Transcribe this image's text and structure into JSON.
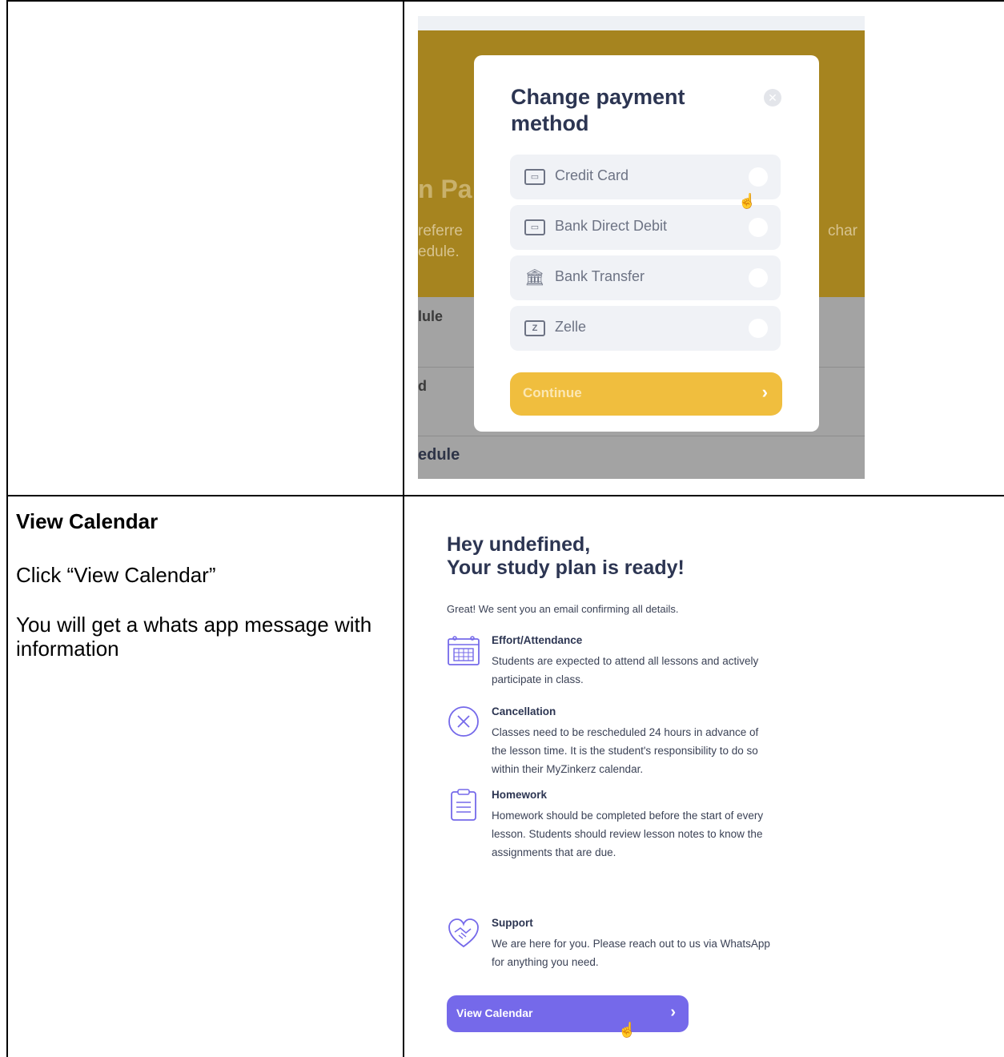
{
  "left_cell": {
    "heading": "View Calendar",
    "step": "Click “View Calendar”",
    "note": "You will get a whats app message with information"
  },
  "screenshot_payment": {
    "background": {
      "title_fragment": "n Pa",
      "text_line1": "referre",
      "text_line2": "edule.",
      "text_right": "char",
      "row1": "lule",
      "row2": "d",
      "row3": "edule"
    },
    "modal": {
      "title": "Change payment method",
      "close_icon": "close-circle-icon",
      "options": [
        {
          "label": "Credit Card",
          "icon": "card-icon"
        },
        {
          "label": "Bank Direct Debit",
          "icon": "card-icon"
        },
        {
          "label": "Bank Transfer",
          "icon": "bank-icon"
        },
        {
          "label": "Zelle",
          "icon": "zelle-icon"
        }
      ],
      "continue_label": "Continue",
      "accent_color": "#f0be3e"
    }
  },
  "screenshot_plan": {
    "title_line1": "Hey undefined,",
    "title_line2": "Your study plan is ready!",
    "subtitle": "Great! We sent you an email confirming all details.",
    "items": [
      {
        "title": "Effort/Attendance",
        "desc": "Students are expected to attend all lessons and actively participate in class.",
        "icon": "calendar-icon"
      },
      {
        "title": "Cancellation",
        "desc": "Classes need to be rescheduled 24 hours in advance of the lesson time. It is the student's responsibility to do so within their MyZinkerz calendar.",
        "icon": "cancel-circle-icon"
      },
      {
        "title": "Homework",
        "desc": "Homework should be completed before the start of every lesson. Students should review lesson notes to know the assignments that are due.",
        "icon": "clipboard-icon"
      },
      {
        "title": "Support",
        "desc": "We are here for you. Please reach out to us via WhatsApp for anything you need.",
        "icon": "handshake-heart-icon"
      }
    ],
    "button_label": "View Calendar",
    "accent_color": "#7569ea"
  }
}
